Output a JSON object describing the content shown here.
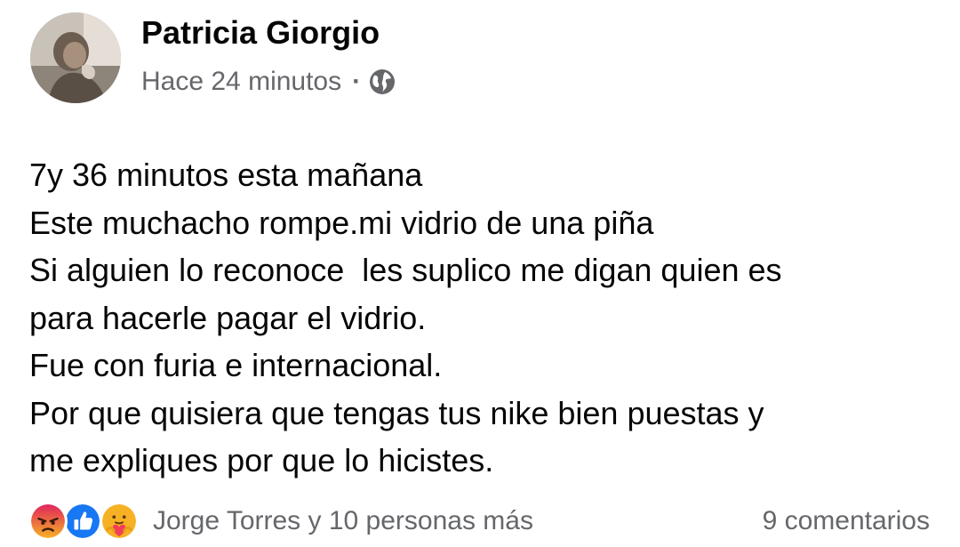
{
  "post": {
    "author_name": "Patricia Giorgio",
    "timestamp": "Hace 24 minutos",
    "separator": "·",
    "audience_icon": "globe-icon",
    "body_lines": [
      "7y 36 minutos esta mañana",
      "Este muchacho rompe.mi vidrio de una piña",
      "Si alguien lo reconoce  les suplico me digan quien es",
      "para hacerle pagar el vidrio.",
      "Fue con furia e internacional.",
      "Por que quisiera que tengas tus nike bien puestas y",
      "me expliques por que lo hicistes."
    ]
  },
  "footer": {
    "reaction_icons": [
      "angry-icon",
      "like-icon",
      "care-icon"
    ],
    "reactors_text": "Jorge Torres y 10 personas más",
    "comments_text": "9 comentarios"
  },
  "colors": {
    "text_primary": "#050505",
    "text_secondary": "#65676b",
    "like_blue": "#1877f2",
    "angry_orange": "#e9710f",
    "care_yellow": "#f7b125"
  }
}
